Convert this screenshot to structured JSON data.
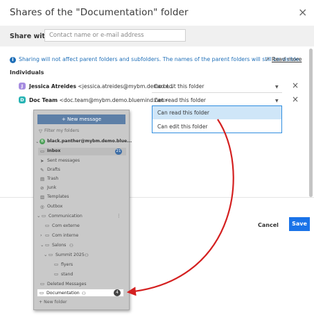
{
  "dialog": {
    "title": "Shares of the \"Documentation\" folder",
    "close_glyph": "×",
    "share_with_label": "Share with",
    "share_input_placeholder": "Contact name or e-mail address",
    "info_text": "Sharing will not affect parent folders and subfolders. The names of the parent folders will still be visible.",
    "read_more": "Read more",
    "section_title": "Individuals"
  },
  "individuals": [
    {
      "initial": "J",
      "avatar_color": "#a58be0",
      "name": "Jessica Atreides",
      "email": "<jessica.atreides@mybm.demo.bl...",
      "permission": "Can edit this folder"
    },
    {
      "initial": "D",
      "avatar_color": "#27b3b4",
      "name": "Doc Team",
      "email": "<doc.team@mybm.demo.bluemind.net>",
      "permission": "Can read this folder"
    }
  ],
  "dropdown_options": [
    "Can read this folder",
    "Can edit this folder"
  ],
  "footer": {
    "cancel": "Cancel",
    "save": "Save"
  },
  "mail_panel": {
    "new_message": "+ New message",
    "filter": "Filter my folders",
    "account": "black.panther@mybm.demo.blue...",
    "account_initial": "B",
    "inbox": "Inbox",
    "inbox_count": "21",
    "sent": "Sent messages",
    "drafts": "Drafts",
    "trash": "Trash",
    "junk": "Junk",
    "templates": "Templates",
    "outbox": "Outbox",
    "communication": "Communication",
    "com_externe": "Com externe",
    "com_interne": "Com interne",
    "salons": "Salons",
    "summit": "Summit 2025",
    "flyers": "flyers",
    "stand": "stand",
    "deleted": "Deleted Messages",
    "documentation": "Documentation",
    "doc_badge": "4",
    "new_folder": "+ New folder"
  },
  "icons": {
    "info": "info-icon",
    "close": "close-icon",
    "external_link": "external-link-icon",
    "caret": "caret-down-icon",
    "remove": "remove-icon",
    "folder": "folder-icon"
  },
  "colors": {
    "accent": "#1a73e8",
    "info": "#1f6fb8",
    "arrow": "#d42020"
  }
}
